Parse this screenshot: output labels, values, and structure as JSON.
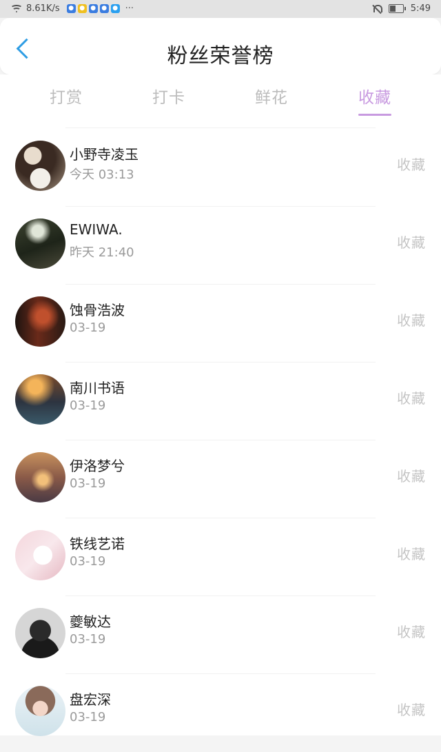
{
  "status_bar": {
    "speed": "8.61K/s",
    "more": "···",
    "time": "5:49",
    "icons": [
      "wifi-icon",
      "paw-app-icon",
      "tieba-app-icon",
      "chrome-app-icon",
      "paw-app-icon",
      "search-app-icon",
      "mute-icon",
      "battery-icon"
    ]
  },
  "header": {
    "title": "粉丝荣誉榜",
    "back_icon": "chevron-left-icon"
  },
  "tabs": [
    {
      "label": "打赏",
      "active": false
    },
    {
      "label": "打卡",
      "active": false
    },
    {
      "label": "鲜花",
      "active": false
    },
    {
      "label": "收藏",
      "active": true
    }
  ],
  "colors": {
    "accent": "#c89ae0",
    "back_blue": "#2f9de4",
    "muted_text": "#9a9a9a",
    "action_text": "#c4c4c4"
  },
  "fans": [
    {
      "name": "小野寺凌玉",
      "time": "今天 03:13",
      "action": "收藏"
    },
    {
      "name": "EWIWA.",
      "time": "昨天 21:40",
      "action": "收藏"
    },
    {
      "name": "蚀骨浩波",
      "time": "03-19",
      "action": "收藏"
    },
    {
      "name": "南川书语",
      "time": "03-19",
      "action": "收藏"
    },
    {
      "name": "伊洛梦兮",
      "time": "03-19",
      "action": "收藏"
    },
    {
      "name": "铁线艺诺",
      "time": "03-19",
      "action": "收藏"
    },
    {
      "name": "夔敏达",
      "time": "03-19",
      "action": "收藏"
    },
    {
      "name": "盘宏深",
      "time": "03-19",
      "action": "收藏"
    }
  ]
}
